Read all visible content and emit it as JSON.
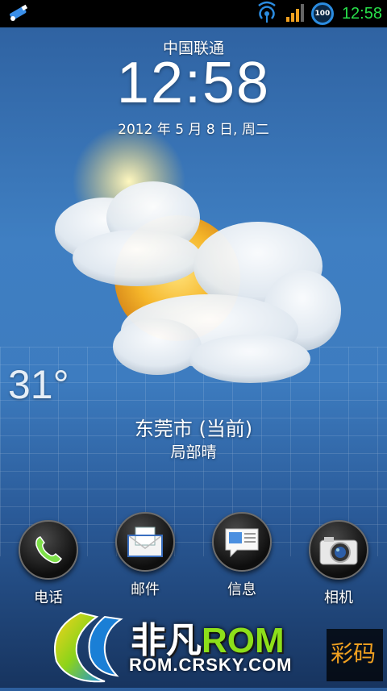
{
  "status_bar": {
    "time": "12:58",
    "battery_level": "100",
    "time_color": "#28e04a"
  },
  "lockscreen": {
    "carrier": "中国联通",
    "clock": "12:58",
    "date": "2012 年 5 月 8 日, 周二"
  },
  "weather": {
    "temperature": "31°",
    "city": "东莞市 (当前)",
    "condition": "局部晴"
  },
  "dock": [
    {
      "label": "电话",
      "icon": "phone-icon"
    },
    {
      "label": "邮件",
      "icon": "mail-icon"
    },
    {
      "label": "信息",
      "icon": "message-icon"
    },
    {
      "label": "相机",
      "icon": "camera-icon"
    }
  ],
  "watermark": {
    "title_part1": "非凡",
    "title_part2": "ROM",
    "url": "ROM.CRSKY.COM"
  }
}
